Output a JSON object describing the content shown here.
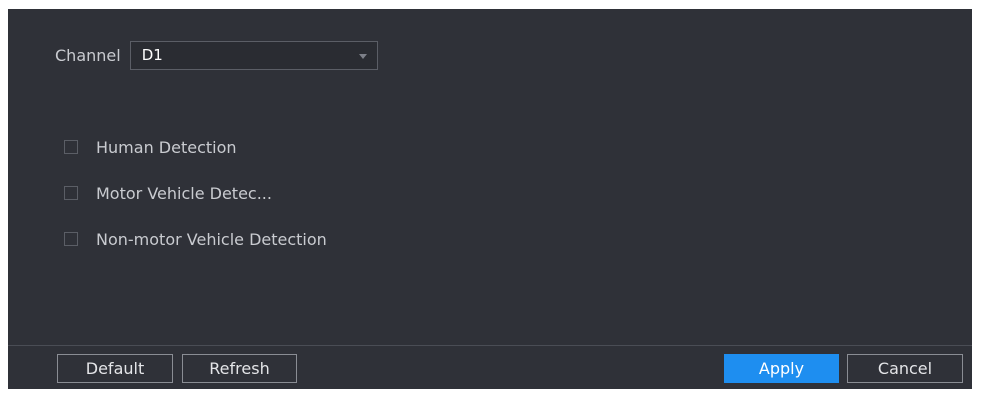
{
  "channel": {
    "label": "Channel",
    "selected": "D1"
  },
  "detections": [
    {
      "label": "Human Detection",
      "checked": false
    },
    {
      "label": "Motor Vehicle Detec...",
      "checked": false
    },
    {
      "label": "Non-motor Vehicle Detection",
      "checked": false
    }
  ],
  "buttons": {
    "default_label": "Default",
    "refresh_label": "Refresh",
    "apply_label": "Apply",
    "cancel_label": "Cancel"
  },
  "colors": {
    "panel_bg": "#2f3138",
    "accent": "#1e8ef0"
  }
}
